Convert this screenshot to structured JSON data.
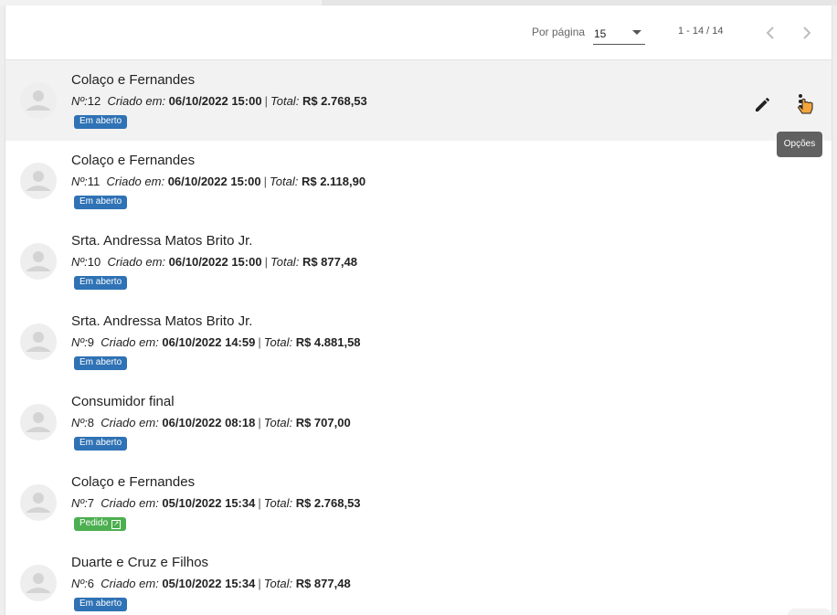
{
  "paginator": {
    "per_page_label": "Por página",
    "per_page_value": "15",
    "range": "1 - 14 / 14"
  },
  "tooltip": "Opções",
  "items": [
    {
      "name": "Colaço e Fernandes",
      "number_label": "Nº:",
      "number": "12",
      "created_label": "Criado em:",
      "created": "06/10/2022 15:00",
      "total_label": "Total:",
      "total": "R$ 2.768,53",
      "status": "Em aberto"
    },
    {
      "name": "Colaço e Fernandes",
      "number_label": "Nº:",
      "number": "11",
      "created_label": "Criado em:",
      "created": "06/10/2022 15:00",
      "total_label": "Total:",
      "total": "R$ 2.118,90",
      "status": "Em aberto"
    },
    {
      "name": "Srta. Andressa Matos Brito Jr.",
      "number_label": "Nº:",
      "number": "10",
      "created_label": "Criado em:",
      "created": "06/10/2022 15:00",
      "total_label": "Total:",
      "total": "R$ 877,48",
      "status": "Em aberto"
    },
    {
      "name": "Srta. Andressa Matos Brito Jr.",
      "number_label": "Nº:",
      "number": "9",
      "created_label": "Criado em:",
      "created": "06/10/2022 14:59",
      "total_label": "Total:",
      "total": "R$ 4.881,58",
      "status": "Em aberto"
    },
    {
      "name": "Consumidor final",
      "number_label": "Nº:",
      "number": "8",
      "created_label": "Criado em:",
      "created": "06/10/2022 08:18",
      "total_label": "Total:",
      "total": "R$ 707,00",
      "status": "Em aberto"
    },
    {
      "name": "Colaço e Fernandes",
      "number_label": "Nº:",
      "number": "7",
      "created_label": "Criado em:",
      "created": "05/10/2022 15:34",
      "total_label": "Total:",
      "total": "R$ 2.768,53",
      "status": "Pedido"
    },
    {
      "name": "Duarte e Cruz e Filhos",
      "number_label": "Nº:",
      "number": "6",
      "created_label": "Criado em:",
      "created": "05/10/2022 15:34",
      "total_label": "Total:",
      "total": "R$ 877,48",
      "status": "Em aberto"
    }
  ],
  "colors": {
    "status_open": "#2f72b5",
    "status_order": "#4caf50",
    "hover_row": "#f2f2f2"
  }
}
